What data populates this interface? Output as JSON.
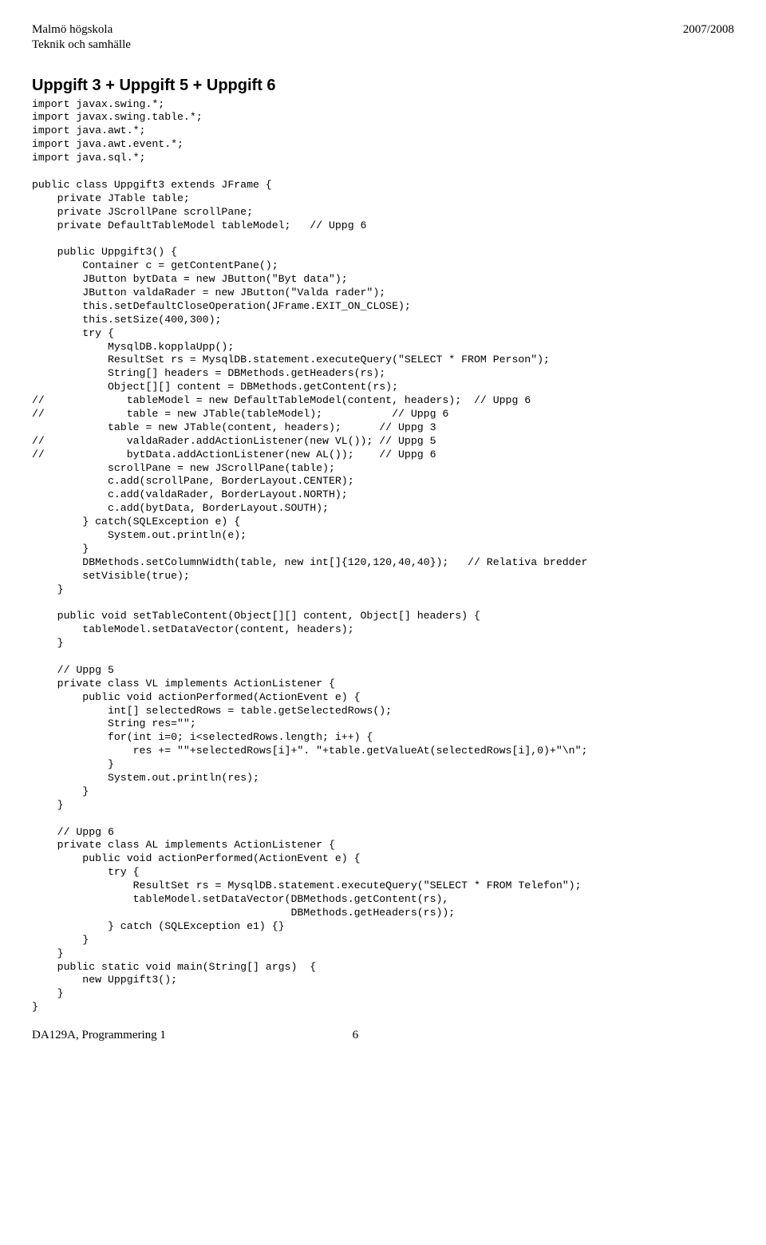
{
  "header": {
    "left_line1": "Malmö högskola",
    "left_line2": "Teknik och samhälle",
    "right": "2007/2008"
  },
  "title": "Uppgift 3 + Uppgift 5 + Uppgift 6",
  "code": "import javax.swing.*;\nimport javax.swing.table.*;\nimport java.awt.*;\nimport java.awt.event.*;\nimport java.sql.*;\n\npublic class Uppgift3 extends JFrame {\n    private JTable table;\n    private JScrollPane scrollPane;\n    private DefaultTableModel tableModel;   // Uppg 6\n\n    public Uppgift3() {\n        Container c = getContentPane();\n        JButton bytData = new JButton(\"Byt data\");\n        JButton valdaRader = new JButton(\"Valda rader\");\n        this.setDefaultCloseOperation(JFrame.EXIT_ON_CLOSE);\n        this.setSize(400,300);\n        try {\n            MysqlDB.kopplaUpp();\n            ResultSet rs = MysqlDB.statement.executeQuery(\"SELECT * FROM Person\");\n            String[] headers = DBMethods.getHeaders(rs);\n            Object[][] content = DBMethods.getContent(rs);\n//             tableModel = new DefaultTableModel(content, headers);  // Uppg 6\n//             table = new JTable(tableModel);           // Uppg 6\n            table = new JTable(content, headers);      // Uppg 3\n//             valdaRader.addActionListener(new VL()); // Uppg 5\n//             bytData.addActionListener(new AL());    // Uppg 6\n            scrollPane = new JScrollPane(table);\n            c.add(scrollPane, BorderLayout.CENTER);\n            c.add(valdaRader, BorderLayout.NORTH);\n            c.add(bytData, BorderLayout.SOUTH);\n        } catch(SQLException e) {\n            System.out.println(e);\n        }\n        DBMethods.setColumnWidth(table, new int[]{120,120,40,40});   // Relativa bredder\n        setVisible(true);\n    }\n\n    public void setTableContent(Object[][] content, Object[] headers) {\n        tableModel.setDataVector(content, headers);\n    }\n\n    // Uppg 5\n    private class VL implements ActionListener {\n        public void actionPerformed(ActionEvent e) {\n            int[] selectedRows = table.getSelectedRows();\n            String res=\"\";\n            for(int i=0; i<selectedRows.length; i++) {\n                res += \"\"+selectedRows[i]+\". \"+table.getValueAt(selectedRows[i],0)+\"\\n\";\n            }\n            System.out.println(res);\n        }\n    }\n\n    // Uppg 6\n    private class AL implements ActionListener {\n        public void actionPerformed(ActionEvent e) {\n            try {\n                ResultSet rs = MysqlDB.statement.executeQuery(\"SELECT * FROM Telefon\");\n                tableModel.setDataVector(DBMethods.getContent(rs),\n                                         DBMethods.getHeaders(rs));\n            } catch (SQLException e1) {}\n        }\n    }\n    public static void main(String[] args)  {\n        new Uppgift3();\n    }\n}",
  "footer": {
    "left": "DA129A, Programmering 1",
    "page": "6"
  }
}
